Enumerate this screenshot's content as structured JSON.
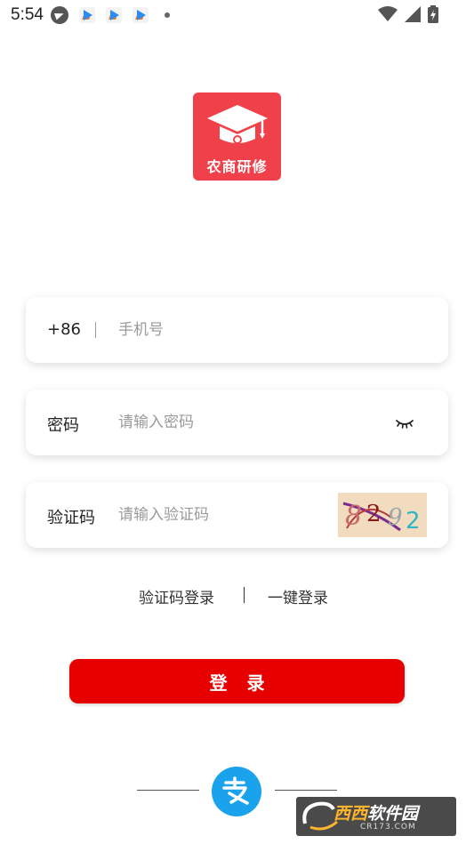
{
  "status_bar": {
    "time": "5:54",
    "icons": [
      "telegram-icon",
      "app-notification-icon",
      "app-notification-icon",
      "app-notification-icon",
      "more-dot-icon",
      "wifi-icon",
      "signal-icon",
      "battery-charging-icon"
    ]
  },
  "logo": {
    "text": "农商研修",
    "icon": "graduation-cap-icon",
    "color": "#f0414a"
  },
  "phone_field": {
    "prefix": "+86",
    "placeholder": "手机号",
    "value": ""
  },
  "password_field": {
    "label": "密码",
    "placeholder": "请输入密码",
    "value": "",
    "toggle_icon": "eye-closed-icon"
  },
  "captcha_field": {
    "label": "验证码",
    "placeholder": "请输入验证码",
    "value": "",
    "captcha_text": "8292"
  },
  "login_options": {
    "sms_login": "验证码登录",
    "one_click_login": "一键登录"
  },
  "login_button": {
    "label": "登录",
    "color": "#e60000"
  },
  "third_party": {
    "alipay_icon": "alipay-icon",
    "alipay_glyph": "支",
    "color": "#1aa2ec"
  },
  "watermark": {
    "brand_a": "西西",
    "brand_b": "软件园",
    "url": "CR173.COM"
  }
}
